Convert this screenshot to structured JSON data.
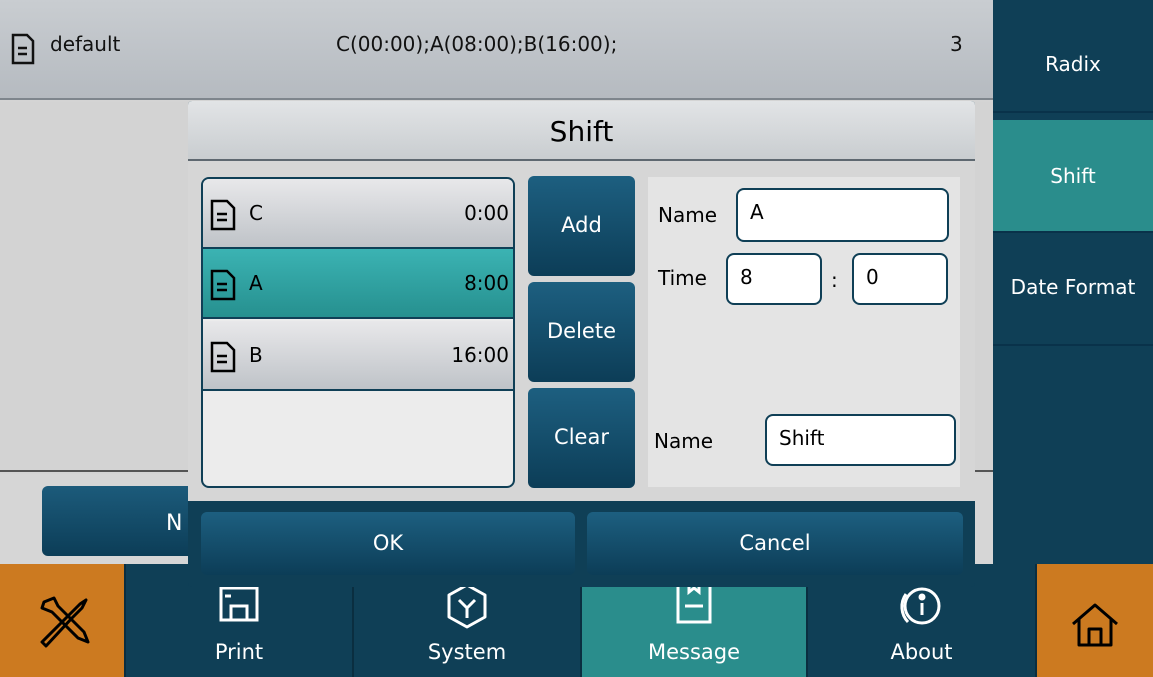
{
  "top_row": {
    "name": "default",
    "value": "C(00:00);A(08:00);B(16:00);",
    "count": "3"
  },
  "background_button": {
    "label_fragment": "N"
  },
  "right_menu": [
    {
      "label": "Radix",
      "active": false
    },
    {
      "label": "Shift",
      "active": true
    },
    {
      "label": "Date Format",
      "active": false
    }
  ],
  "bottom_nav": {
    "tabs": [
      {
        "label": "Print",
        "icon": "printer-icon"
      },
      {
        "label": "System",
        "icon": "hexagon-icon"
      },
      {
        "label": "Message",
        "icon": "bookmark-doc-icon",
        "active": true
      },
      {
        "label": "About",
        "icon": "info-icon"
      }
    ],
    "left_icon": "tools-icon",
    "right_icon": "home-icon"
  },
  "dialog": {
    "title": "Shift",
    "shifts": [
      {
        "name": "C",
        "time": "0:00",
        "selected": false
      },
      {
        "name": "A",
        "time": "8:00",
        "selected": true
      },
      {
        "name": "B",
        "time": "16:00",
        "selected": false
      }
    ],
    "actions": {
      "add": "Add",
      "delete": "Delete",
      "clear": "Clear"
    },
    "editor": {
      "name_label": "Name",
      "name_value": "A",
      "time_label": "Time",
      "hour_value": "8",
      "colon": ":",
      "minute_value": "0",
      "group_name_label": "Name",
      "group_name_value": "Shift"
    },
    "ok_label": "OK",
    "cancel_label": "Cancel"
  },
  "colors": {
    "dark": "#0f3f56",
    "accent": "#2a8d8c",
    "orange": "#cc7a20"
  }
}
